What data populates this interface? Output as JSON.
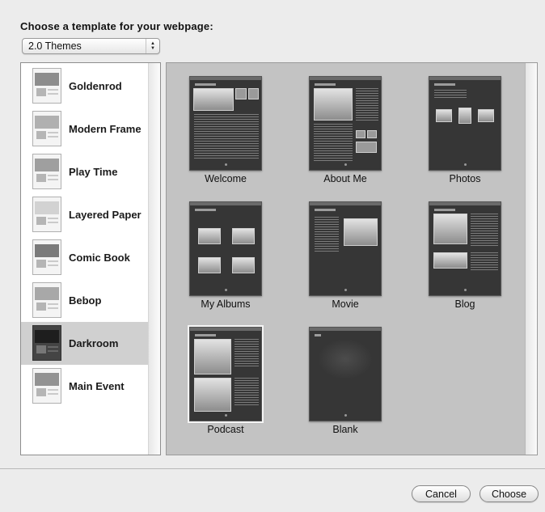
{
  "dialog": {
    "heading": "Choose a template for your webpage:",
    "theme_set_select": {
      "value": "2.0 Themes"
    }
  },
  "themes": [
    {
      "label": "Goldenrod",
      "selected": false
    },
    {
      "label": "Modern Frame",
      "selected": false
    },
    {
      "label": "Play Time",
      "selected": false
    },
    {
      "label": "Layered Paper",
      "selected": false
    },
    {
      "label": "Comic Book",
      "selected": false
    },
    {
      "label": "Bebop",
      "selected": false
    },
    {
      "label": "Darkroom",
      "selected": true
    },
    {
      "label": "Main Event",
      "selected": false
    }
  ],
  "pages": [
    {
      "label": "Welcome"
    },
    {
      "label": "About Me"
    },
    {
      "label": "Photos"
    },
    {
      "label": "My Albums"
    },
    {
      "label": "Movie"
    },
    {
      "label": "Blog"
    },
    {
      "label": "Podcast"
    },
    {
      "label": "Blank"
    }
  ],
  "buttons": {
    "cancel": "Cancel",
    "choose": "Choose"
  },
  "colors": {
    "selection": "#d0d0d0",
    "grid_background": "#c3c3c3",
    "dialog_background": "#ececec"
  }
}
